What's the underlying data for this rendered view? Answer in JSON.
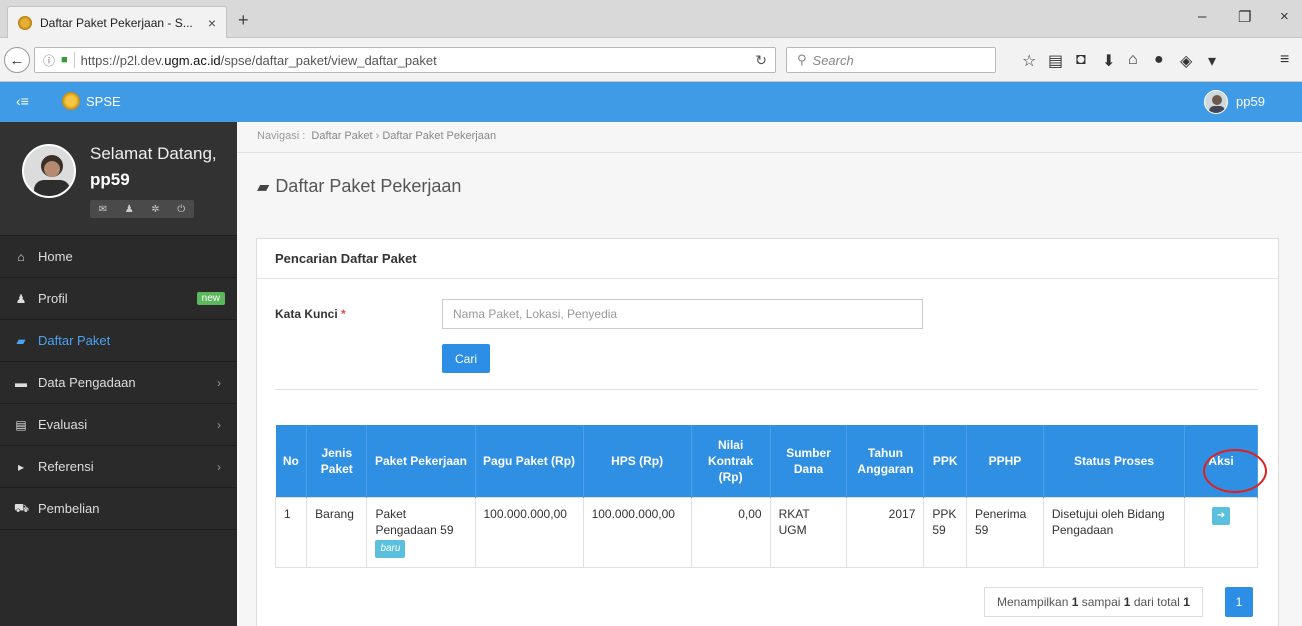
{
  "browser": {
    "tab_title": "Daftar Paket Pekerjaan - S...",
    "tab_close": "×",
    "new_tab": "+",
    "url_prefix": "https://p2l.dev.",
    "url_domain": "ugm.ac.id",
    "url_path": "/spse/daftar_paket/view_daftar_paket",
    "search_placeholder": "Search",
    "win_min": "–",
    "win_max": "❐",
    "win_close": "×"
  },
  "app": {
    "brand": "SPSE",
    "username": "pp59"
  },
  "sidebar": {
    "welcome": "Selamat Datang,",
    "username": "pp59",
    "items": [
      {
        "label": "Home",
        "icon": "home-icon",
        "glyph": "⌂"
      },
      {
        "label": "Profil",
        "icon": "user-icon",
        "glyph": "♟",
        "badge": "new"
      },
      {
        "label": "Daftar Paket",
        "icon": "book-icon",
        "glyph": "▰",
        "active": true
      },
      {
        "label": "Data Pengadaan",
        "icon": "briefcase-icon",
        "glyph": "▬",
        "chevron": "›"
      },
      {
        "label": "Evaluasi",
        "icon": "document-icon",
        "glyph": "▤",
        "chevron": "›"
      },
      {
        "label": "Referensi",
        "icon": "caret-right-icon",
        "glyph": "▸",
        "chevron": "›"
      },
      {
        "label": "Pembelian",
        "icon": "cart-icon",
        "glyph": "⛟"
      }
    ]
  },
  "breadcrumb": {
    "prefix": "Navigasi :",
    "item1": "Daftar Paket",
    "sep": "›",
    "item2": "Daftar Paket Pekerjaan"
  },
  "page_title": "Daftar Paket Pekerjaan",
  "panel": {
    "title": "Pencarian Daftar Paket",
    "keyword_label": "Kata Kunci",
    "required_mark": "*",
    "keyword_placeholder": "Nama Paket, Lokasi, Penyedia",
    "search_button": "Cari"
  },
  "table": {
    "headers": [
      "No",
      "Jenis Paket",
      "Paket Pekerjaan",
      "Pagu Paket (Rp)",
      "HPS (Rp)",
      "Nilai Kontrak (Rp)",
      "Sumber Dana",
      "Tahun Anggaran",
      "PPK",
      "PPHP",
      "Status Proses",
      "Aksi"
    ],
    "rows": [
      {
        "no": "1",
        "jenis": "Barang",
        "paket": "Paket Pengadaan 59",
        "paket_badge": "baru",
        "pagu": "100.000.000,00",
        "hps": "100.000.000,00",
        "nilai": "0,00",
        "sumber": "RKAT UGM",
        "tahun": "2017",
        "ppk": "PPK 59",
        "pphp": "Penerima 59",
        "status": "Disetujui oleh Bidang Pengadaan",
        "aksi_icon": "arrow-circle-right-icon"
      }
    ]
  },
  "pagination": {
    "prefix": "Menampilkan",
    "from": "1",
    "mid1": "sampai",
    "to": "1",
    "mid2": "dari total",
    "total": "1",
    "current_page": "1"
  }
}
